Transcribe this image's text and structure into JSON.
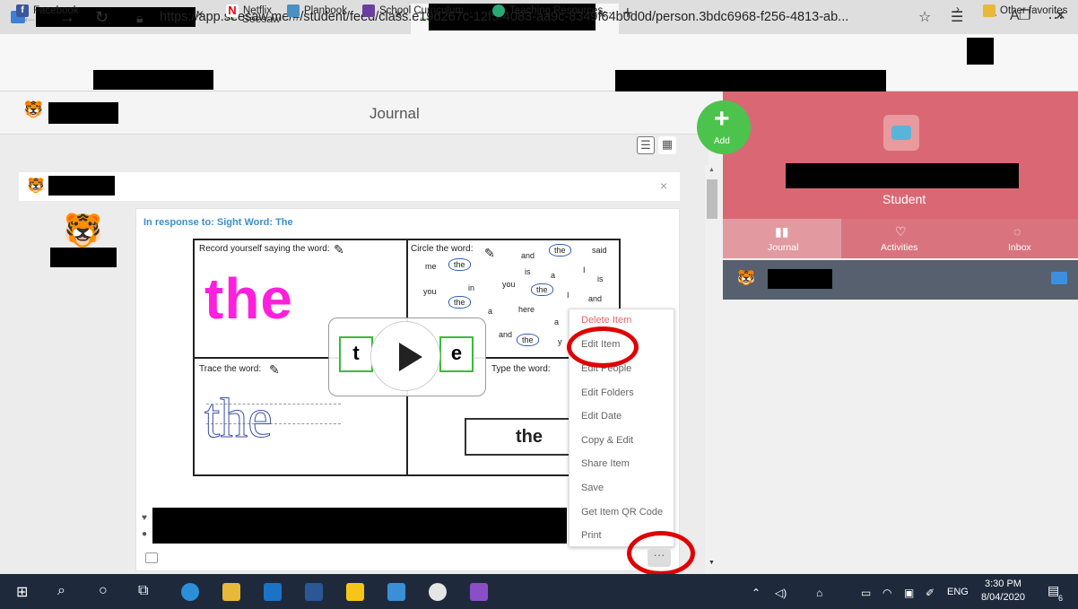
{
  "browser": {
    "tabs": [
      {
        "title": ""
      },
      {
        "title": "Seesaw"
      },
      {
        "title": ""
      }
    ],
    "url": "https://app.seesaw.me/#/student/feed/class.e19d267c-12f5-4083-aa9c-8349f64b0d0d/person.3bdc6968-f256-4813-ab...",
    "favorites": [
      "Facebook",
      "Netflix",
      "Planbook",
      "School Curriculum...",
      "Teaching Resources..."
    ],
    "other_favorites": "Other favorites"
  },
  "page": {
    "title": "Journal",
    "add_label": "Add",
    "response_to": "In response to: Sight Word: The"
  },
  "worksheet": {
    "record_label": "Record yourself saying the word:",
    "circle_label": "Circle the word:",
    "trace_label": "Trace the word:",
    "type_label": "Type the word:",
    "big_word": "the",
    "trace_word": "the",
    "typed_word": "the",
    "letters": [
      "t",
      "e"
    ],
    "circle_words": [
      "and",
      "the",
      "said",
      "me",
      "the",
      "is",
      "a",
      "I",
      "is",
      "you",
      "in",
      "you",
      "the",
      "I",
      "and",
      "the",
      "a",
      "here",
      "a",
      "and",
      "the",
      "y"
    ]
  },
  "menu": {
    "items": [
      "Delete Item",
      "Edit Item",
      "Edit People",
      "Edit Folders",
      "Edit Date",
      "Copy & Edit",
      "Share Item",
      "Save",
      "Get Item QR Code",
      "Print"
    ],
    "more_label": "···"
  },
  "right_panel": {
    "role": "Student",
    "tabs": [
      "Journal",
      "Activities",
      "Inbox"
    ]
  },
  "taskbar": {
    "time": "3:30 PM",
    "date": "8/04/2020",
    "lang": "ENG",
    "notifications": "6"
  },
  "colors": {
    "accent_pink": "#d96874",
    "add_green": "#4cc34c",
    "annotation_red": "#e00000",
    "big_word_magenta": "#ff1fdd"
  }
}
